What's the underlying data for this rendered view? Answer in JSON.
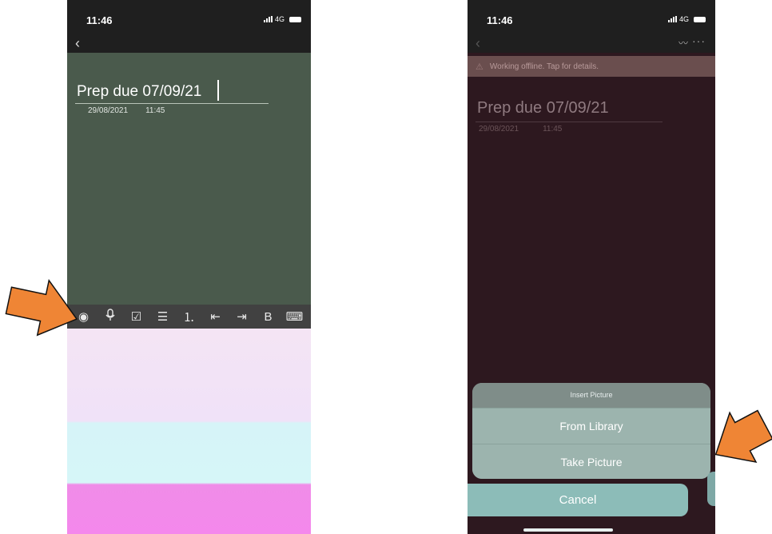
{
  "left_phone": {
    "status": {
      "time": "11:46",
      "network": "4G"
    },
    "note": {
      "title": "Prep due 07/09/21",
      "date": "29/08/2021",
      "time": "11:45"
    },
    "toolbar": {
      "camera": "◉",
      "mic": "🎙",
      "checkbox": "☑",
      "bullets": "☰",
      "numbered": "⒈",
      "outdent": "⇤",
      "indent": "⇥",
      "format": "B",
      "keyboard": "⌨"
    }
  },
  "right_phone": {
    "status": {
      "time": "11:46",
      "network": "4G"
    },
    "offline_banner": "Working offline. Tap for details.",
    "note": {
      "title": "Prep due 07/09/21",
      "date": "29/08/2021",
      "time": "11:45"
    },
    "sheet": {
      "title": "Insert Picture",
      "options": [
        "From Library",
        "Take Picture"
      ],
      "cancel": "Cancel"
    }
  },
  "colors": {
    "arrow": "#ef8535",
    "arrow_stroke": "#111111"
  },
  "icons": [
    "back-icon",
    "pen-icon",
    "more-icon",
    "warning-icon",
    "camera-icon",
    "mic-icon",
    "checkbox-icon",
    "bullets-icon",
    "numbered-list-icon",
    "outdent-icon",
    "indent-icon",
    "format-icon",
    "keyboard-icon"
  ]
}
